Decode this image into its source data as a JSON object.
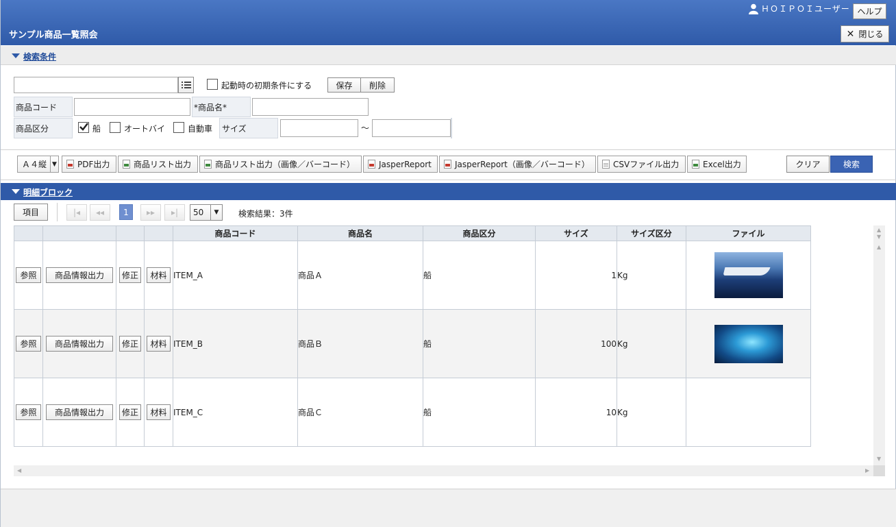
{
  "header": {
    "title": "サンプル商品一覧照会",
    "user": "ＨＯＩＰＯＩユーザー",
    "help": "ヘルプ",
    "close": "閉じる"
  },
  "search": {
    "section_title": "検索条件",
    "save": "保存",
    "delete": "削除",
    "default_check_label": "起動時の初期条件にする",
    "code_label": "商品コード",
    "name_label": "*商品名*",
    "category_label": "商品区分",
    "cat_options": [
      {
        "label": "船",
        "checked": true
      },
      {
        "label": "オートバイ",
        "checked": false
      },
      {
        "label": "自動車",
        "checked": false
      }
    ],
    "size_label": "サイズ",
    "size_sep": "～"
  },
  "toolbar": {
    "paper": "Ａ４縦",
    "pdf": "PDF出力",
    "list": "商品リスト出力",
    "list_img": "商品リスト出力（画像／バーコード）",
    "jasper": "JasperReport",
    "jasper_img": "JasperReport（画像／バーコード）",
    "csv": "CSVファイル出力",
    "excel": "Excel出力",
    "clear": "クリア",
    "search": "検索"
  },
  "detail": {
    "section_title": "明細ブロック",
    "items_btn": "項目",
    "page": "1",
    "page_size": "50",
    "result": "検索結果：3件",
    "columns": [
      "商品コード",
      "商品名",
      "商品区分",
      "サイズ",
      "サイズ区分",
      "ファイル"
    ],
    "row_buttons": {
      "ref": "参照",
      "info": "商品情報出力",
      "edit": "修正",
      "material": "材料"
    },
    "rows": [
      {
        "code": "ITEM_A",
        "name": "商品Ａ",
        "category": "船",
        "size": "1",
        "unit": "Kg",
        "image": "ship"
      },
      {
        "code": "ITEM_B",
        "name": "商品Ｂ",
        "category": "船",
        "size": "100",
        "unit": "Kg",
        "image": "aurora"
      },
      {
        "code": "ITEM_C",
        "name": "商品Ｃ",
        "category": "船",
        "size": "10",
        "unit": "Kg",
        "image": ""
      }
    ]
  },
  "colors": {
    "header": "#2f5aa8",
    "accent": "#3a63b3"
  }
}
